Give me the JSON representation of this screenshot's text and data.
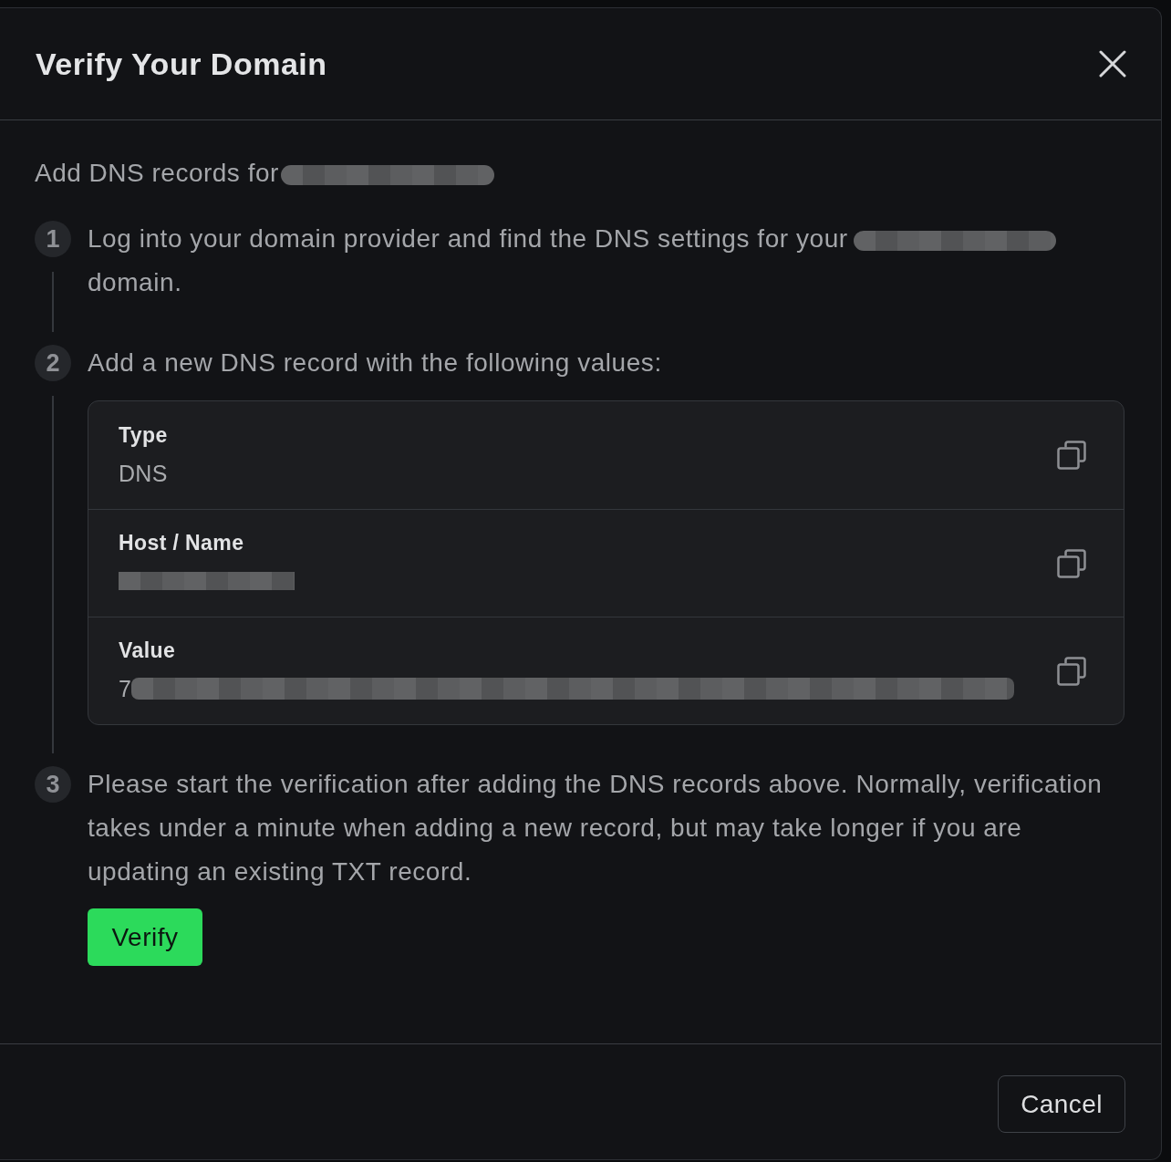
{
  "dialog": {
    "title": "Verify Your Domain"
  },
  "intro": {
    "text": "Add DNS records for",
    "redacted": true
  },
  "steps": [
    {
      "kind": "text",
      "number": "1",
      "text": "Log into your domain provider and find the DNS settings for your",
      "redacted": true,
      "text_after": "domain."
    },
    {
      "kind": "records",
      "number": "2",
      "text": "Add a new DNS record with the following values:",
      "records": [
        {
          "label": "Type",
          "value": "DNS"
        },
        {
          "label": "Host / Name",
          "redacted": true
        },
        {
          "label": "Value",
          "value": "7",
          "redacted": true
        }
      ]
    },
    {
      "kind": "action",
      "number": "3",
      "text": "Please start the verification after adding the DNS records above. Normally, verification takes under a minute when adding a new record, but may take longer if you are updating an existing TXT record.",
      "button": "Verify"
    }
  ],
  "footer": {
    "cancel": "Cancel"
  }
}
